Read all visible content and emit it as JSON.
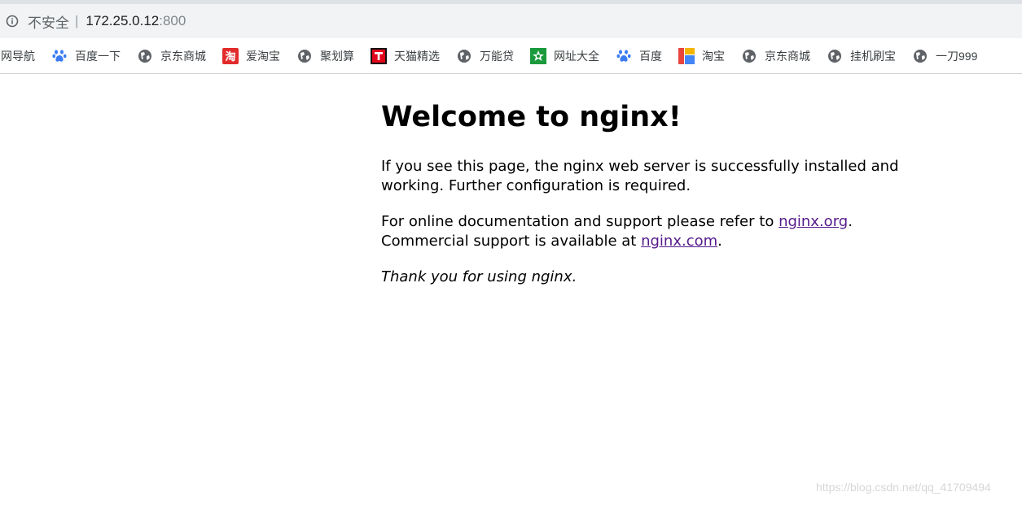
{
  "address_bar": {
    "security_label": "不安全",
    "separator": "|",
    "url_host": "172.25.0.12",
    "url_port": ":800"
  },
  "bookmarks": [
    {
      "label": "网导航",
      "icon": "none"
    },
    {
      "label": "百度一下",
      "icon": "paw-icon"
    },
    {
      "label": "京东商城",
      "icon": "globe-icon"
    },
    {
      "label": "爱淘宝",
      "icon": "taobao-icon"
    },
    {
      "label": "聚划算",
      "icon": "globe-icon"
    },
    {
      "label": "天猫精选",
      "icon": "tmall-icon"
    },
    {
      "label": "万能贷",
      "icon": "globe-icon"
    },
    {
      "label": "网址大全",
      "icon": "star-icon"
    },
    {
      "label": "百度",
      "icon": "paw-icon"
    },
    {
      "label": "淘宝",
      "icon": "color-blocks-icon"
    },
    {
      "label": "京东商城",
      "icon": "globe-icon"
    },
    {
      "label": "挂机刷宝",
      "icon": "globe-icon"
    },
    {
      "label": "一刀999",
      "icon": "globe-icon"
    }
  ],
  "page": {
    "heading": "Welcome to nginx!",
    "p1": "If you see this page, the nginx web server is successfully installed and working. Further configuration is required.",
    "p2_before": "For online documentation and support please refer to ",
    "p2_link1": "nginx.org",
    "p2_mid": ".",
    "p2_line2": "Commercial support is available at ",
    "p2_link2": "nginx.com",
    "p2_end": ".",
    "p3": "Thank you for using nginx."
  },
  "watermark": "https://blog.csdn.net/qq_41709494",
  "colors": {
    "link_visited": "#551a8b",
    "address_bar_bg": "#f1f3f4"
  }
}
